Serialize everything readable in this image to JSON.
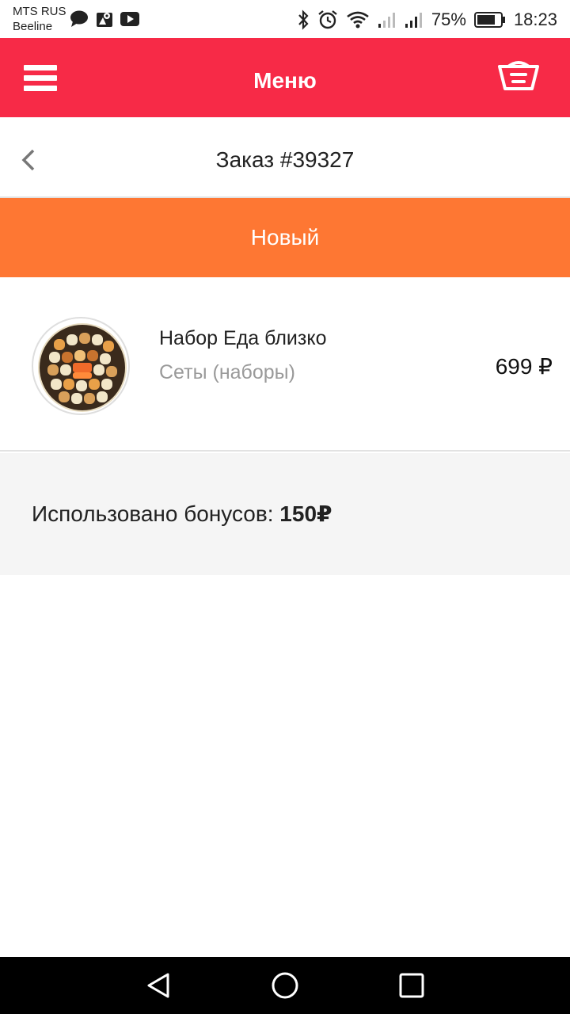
{
  "status_bar": {
    "carrier_1": "MTS RUS",
    "carrier_2": "Beeline",
    "battery": "75%",
    "time": "18:23"
  },
  "app_bar": {
    "title": "Меню",
    "menu_icon": "hamburger-icon",
    "cart_icon": "cart-icon"
  },
  "order": {
    "title": "Заказ #39327",
    "status": "Новый"
  },
  "items": [
    {
      "name": "Набор Еда близко",
      "category": "Сеты (наборы)",
      "price": "699 ₽"
    }
  ],
  "bonus": {
    "label": "Использовано бонусов:",
    "value": "150₽"
  },
  "colors": {
    "app_bar": "#f72a47",
    "status_new": "#fe7733",
    "bonus_bg": "#f5f5f5"
  }
}
